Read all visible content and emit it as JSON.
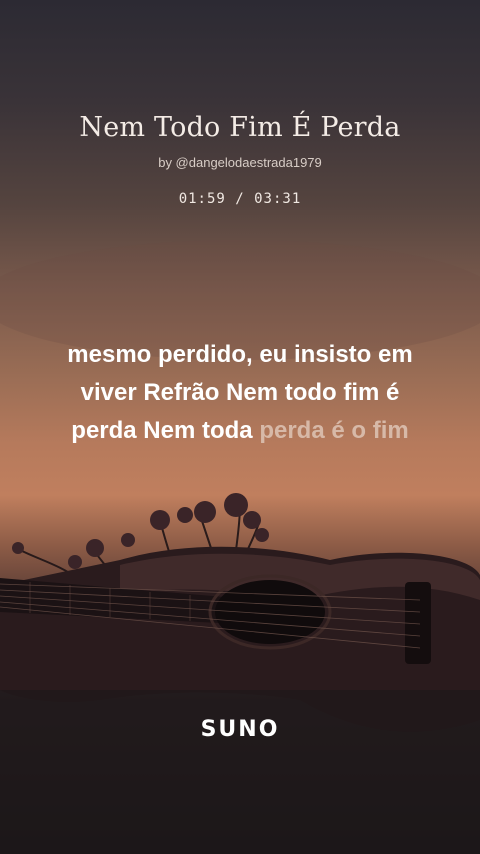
{
  "song": {
    "title": "Nem Todo Fim É Perda",
    "artist": "by @dangelodaestrada1979",
    "time": "01:59 / 03:31"
  },
  "lyrics": {
    "line1": "mesmo perdido, eu insisto em",
    "line2": "viver Refrão Nem todo fim é",
    "line3_sung": "perda Nem toda ",
    "line3_upcoming": "perda é o fim"
  },
  "brand": {
    "logo_text": "SUNO"
  },
  "colors": {
    "lyric_active": "#ffffff",
    "lyric_upcoming": "#d7b9a8"
  }
}
